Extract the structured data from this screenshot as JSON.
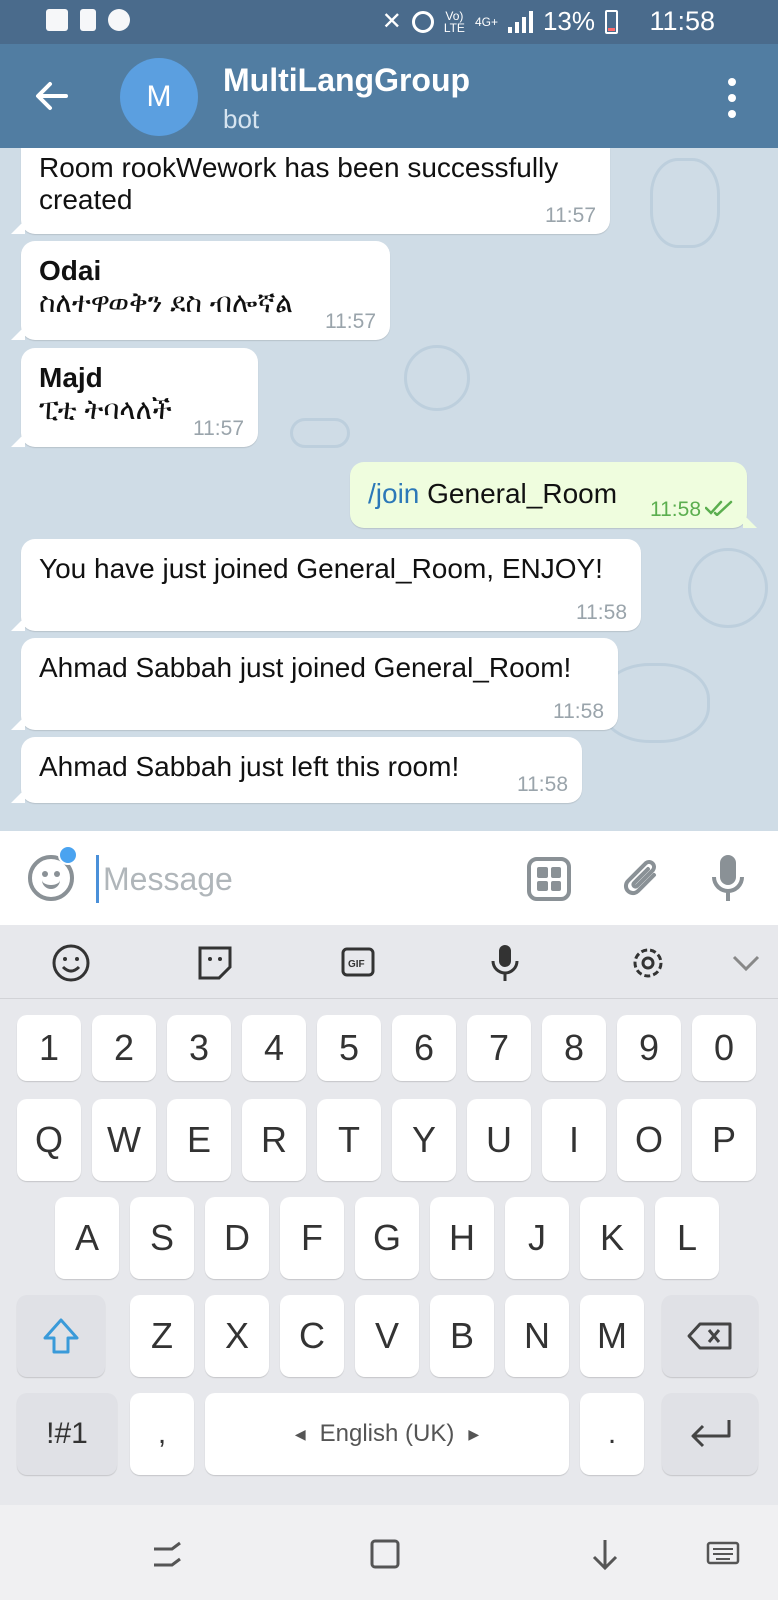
{
  "status_bar": {
    "network": "LTE",
    "signal_label": "4G+",
    "battery": "13%",
    "time": "11:58",
    "icons": [
      "image-icon",
      "alert-icon",
      "phone-icon",
      "mute-icon",
      "alarm-icon",
      "volte-icon",
      "signal-icon",
      "battery-icon"
    ]
  },
  "header": {
    "avatar_letter": "M",
    "title": "MultiLangGroup",
    "subtitle": "bot"
  },
  "messages": [
    {
      "text": "Room rookWework has been successfully created",
      "time": "11:57"
    },
    {
      "sender": "Odai",
      "text": "ስለተዋወቅን ደስ ብሎኛል",
      "time": "11:57"
    },
    {
      "sender": "Majd",
      "text": "ፒቲ ትባላለች",
      "time": "11:57"
    },
    {
      "command": "/join",
      "text": "General_Room",
      "time": "11:58",
      "status": "read"
    },
    {
      "text": "You have just joined General_Room, ENJOY!",
      "time": "11:58"
    },
    {
      "text": "Ahmad Sabbah just joined General_Room!",
      "time": "11:58"
    },
    {
      "text": "Ahmad Sabbah just left this room!",
      "time": "11:58"
    }
  ],
  "composer": {
    "placeholder": "Message",
    "value": ""
  },
  "keyboard": {
    "tools": [
      "emoji-icon",
      "sticker-icon",
      "gif-icon",
      "voice-input-icon",
      "settings-icon",
      "collapse-icon"
    ],
    "row_numbers": [
      "1",
      "2",
      "3",
      "4",
      "5",
      "6",
      "7",
      "8",
      "9",
      "0"
    ],
    "row_q": [
      "Q",
      "W",
      "E",
      "R",
      "T",
      "Y",
      "U",
      "I",
      "O",
      "P"
    ],
    "row_a": [
      "A",
      "S",
      "D",
      "F",
      "G",
      "H",
      "J",
      "K",
      "L"
    ],
    "row_z": [
      "Z",
      "X",
      "C",
      "V",
      "B",
      "N",
      "M"
    ],
    "symbols_label": "!#1",
    "comma": ",",
    "space_label": "English (UK)",
    "period": "."
  },
  "colors": {
    "app_bar": "#517da2",
    "status_bar": "#4a6b8c",
    "chat_bg": "#cfdce6",
    "outgoing_bubble": "#effdde",
    "accent": "#4aa3f0"
  }
}
